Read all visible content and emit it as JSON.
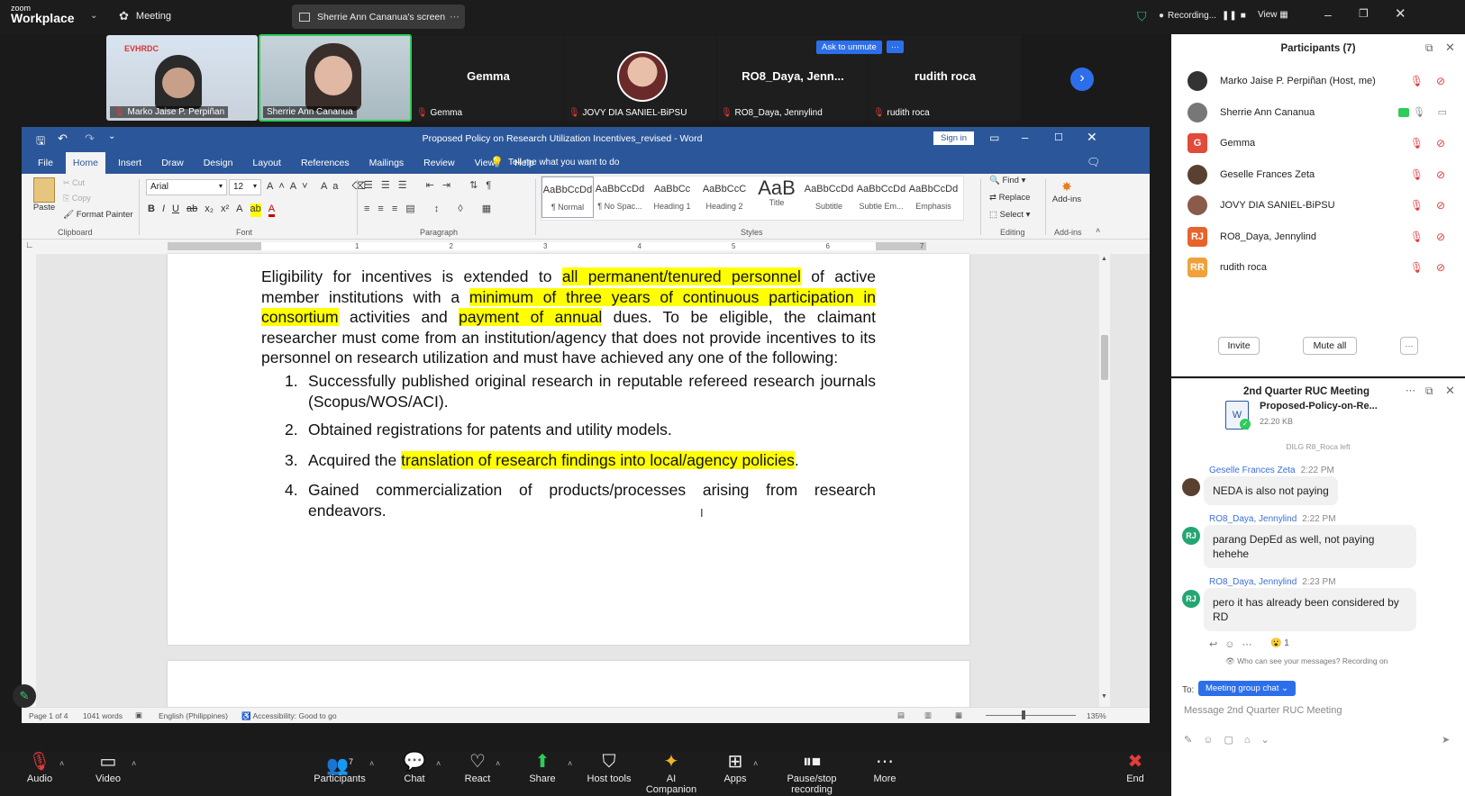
{
  "zoom_top": {
    "logo_line1": "zoom",
    "logo_line2": "Workplace",
    "meeting_label": "Meeting",
    "screen_share_label": "Sherrie Ann Cananua's screen",
    "recording_label": "Recording...",
    "view_label": "View"
  },
  "video_strip": {
    "tiles": [
      {
        "name": "Marko Jaise P. Perpiñan",
        "banner": "EVHRDC"
      },
      {
        "name": "Sherrie Ann Cananua"
      },
      {
        "name": "Gemma",
        "center": "Gemma"
      },
      {
        "name": "JOVY DIA SANIEL-BiPSU"
      },
      {
        "name": "RO8_Daya, Jennylind",
        "center": "RO8_Daya, Jenn..."
      },
      {
        "name": "rudith roca",
        "center": "rudith roca"
      }
    ],
    "ask_to_unmute": "Ask to unmute",
    "more": "···"
  },
  "word": {
    "title": "Proposed Policy on Research Utilization Incentives_revised  -  Word",
    "sign_in": "Sign in",
    "tabs": [
      "File",
      "Home",
      "Insert",
      "Draw",
      "Design",
      "Layout",
      "References",
      "Mailings",
      "Review",
      "View",
      "Help"
    ],
    "tell_me": "Tell me what you want to do",
    "clipboard": {
      "paste": "Paste",
      "cut": "Cut",
      "copy": "Copy",
      "format_painter": "Format Painter",
      "group": "Clipboard"
    },
    "font": {
      "name": "Arial",
      "size": "12",
      "group": "Font"
    },
    "paragraph_group": "Paragraph",
    "styles": [
      {
        "preview": "AaBbCcDd",
        "name": "¶ Normal"
      },
      {
        "preview": "AaBbCcDd",
        "name": "¶ No Spac..."
      },
      {
        "preview": "AaBbCc",
        "name": "Heading 1"
      },
      {
        "preview": "AaBbCcC",
        "name": "Heading 2"
      },
      {
        "preview": "AaB",
        "name": "Title"
      },
      {
        "preview": "AaBbCcDd",
        "name": "Subtitle"
      },
      {
        "preview": "AaBbCcDd",
        "name": "Subtle Em..."
      },
      {
        "preview": "AaBbCcDd",
        "name": "Emphasis"
      }
    ],
    "styles_group": "Styles",
    "editing": {
      "find": "Find",
      "replace": "Replace",
      "select": "Select",
      "group": "Editing"
    },
    "addins": {
      "label": "Add-ins",
      "group": "Add-ins"
    },
    "ruler_numbers": [
      "1",
      "2",
      "3",
      "4",
      "5",
      "6",
      "7"
    ],
    "doc": {
      "para_parts": [
        {
          "t": "Eligibility for incentives is extended to ",
          "hl": false
        },
        {
          "t": "all permanent/tenured personnel",
          "hl": true
        },
        {
          "t": " of active member institutions with a ",
          "hl": false
        },
        {
          "t": "minimum of three years of continuous participation in consortium",
          "hl": true
        },
        {
          "t": " activities and ",
          "hl": false
        },
        {
          "t": "payment of annual",
          "hl": true
        },
        {
          "t": " dues. To be eligible, the claimant researcher must come from an institution/agency that does not provide incentives to its personnel on research utilization and must have achieved any one of the following:",
          "hl": false
        }
      ],
      "list": [
        {
          "num": "1.",
          "pre": "Successfully published original research in reputable refereed research journals (Scopus/WOS/ACI).",
          "hl": "",
          "post": ""
        },
        {
          "num": "2.",
          "pre": "Obtained registrations for patents and utility models.",
          "hl": "",
          "post": ""
        },
        {
          "num": "3.",
          "pre": "Acquired the ",
          "hl": "translation of research findings into local/agency policies",
          "post": "."
        },
        {
          "num": "4.",
          "pre": "Gained commercialization of products/processes arising from research endeavors.",
          "hl": "",
          "post": ""
        }
      ]
    },
    "status": {
      "page": "Page 1 of 4",
      "words": "1041 words",
      "language": "English (Philippines)",
      "accessibility": "Accessibility: Good to go",
      "zoom": "135%"
    }
  },
  "participants": {
    "title": "Participants (7)",
    "list": [
      {
        "name": "Marko Jaise P. Perpiñan (Host, me)",
        "initial": "",
        "color": "#333333",
        "muted": true
      },
      {
        "name": "Sherrie Ann Cananua",
        "initial": "",
        "color": "#777777",
        "muted": false
      },
      {
        "name": "Gemma",
        "initial": "G",
        "color": "#e04b3a",
        "muted": true
      },
      {
        "name": "Geselle Frances Zeta",
        "initial": "",
        "color": "#5a4030",
        "muted": true
      },
      {
        "name": "JOVY DIA SANIEL-BiPSU",
        "initial": "",
        "color": "#8a5a4a",
        "muted": true
      },
      {
        "name": "RO8_Daya, Jennylind",
        "initial": "RJ",
        "color": "#e8632b",
        "muted": true
      },
      {
        "name": "rudith roca",
        "initial": "RR",
        "color": "#f0a13a",
        "muted": true
      }
    ],
    "invite": "Invite",
    "mute_all": "Mute all",
    "more": "···"
  },
  "chat": {
    "title": "2nd Quarter RUC Meeting",
    "file_name": "Proposed-Policy-on-Re...",
    "file_size": "22.20 KB",
    "system_msg": "DILG R8_Roca left",
    "messages": [
      {
        "sender": "Geselle Frances Zeta",
        "time": "2:22 PM",
        "text": "NEDA is also not paying"
      },
      {
        "sender": "RO8_Daya, Jennylind",
        "time": "2:22 PM",
        "text": "parang DepEd as well, not paying hehehe"
      },
      {
        "sender": "RO8_Daya, Jennylind",
        "time": "2:23 PM",
        "text": "pero it has already been considered by RD"
      }
    ],
    "reaction_count": "1",
    "privacy_note": "Who can see your messages? Recording on",
    "to_label": "To:",
    "to_target": "Meeting group chat",
    "input_placeholder": "Message 2nd Quarter RUC Meeting"
  },
  "toolbar": {
    "audio": "Audio",
    "video": "Video",
    "participants": "Participants",
    "participant_count": "7",
    "chat": "Chat",
    "react": "React",
    "share": "Share",
    "host_tools": "Host tools",
    "ai_companion": "AI Companion",
    "apps": "Apps",
    "pause_recording": "Pause/stop recording",
    "more": "More",
    "end": "End"
  }
}
